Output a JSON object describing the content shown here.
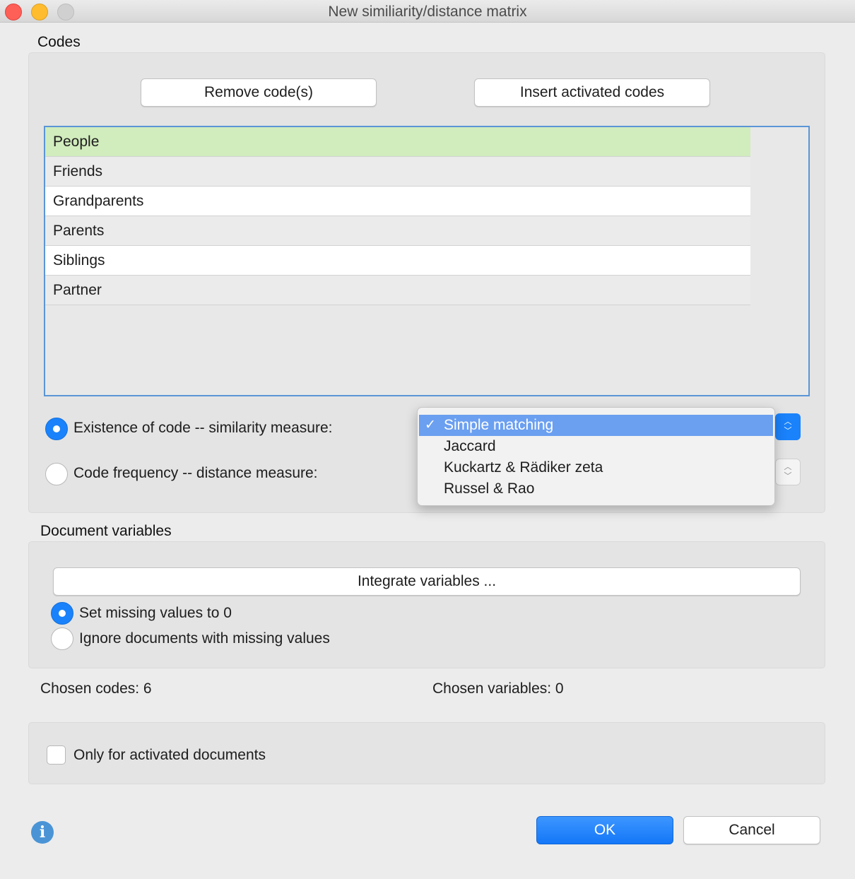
{
  "window": {
    "title": "New similiarity/distance matrix"
  },
  "codes": {
    "section_label": "Codes",
    "remove_button": "Remove code(s)",
    "insert_button": "Insert activated codes",
    "items": [
      {
        "label": "People"
      },
      {
        "label": "Friends"
      },
      {
        "label": "Grandparents"
      },
      {
        "label": "Parents"
      },
      {
        "label": "Siblings"
      },
      {
        "label": "Partner"
      }
    ],
    "selected_item": "People"
  },
  "measure": {
    "existence_label": "Existence of code -- similarity measure:",
    "frequency_label": "Code frequency -- distance measure:",
    "selected_radio": "existence",
    "dropdown_options": [
      "Simple matching",
      "Jaccard",
      "Kuckartz & Rädiker zeta",
      "Russel & Rao"
    ],
    "dropdown_selected": "Simple matching",
    "checkmark": "✓"
  },
  "variables": {
    "section_label": "Document variables",
    "integrate_button": "Integrate variables ...",
    "missing_zero_label": "Set missing values to 0",
    "ignore_missing_label": "Ignore documents with missing values",
    "selected_radio": "missing_zero"
  },
  "summary": {
    "chosen_codes": "Chosen codes: 6",
    "chosen_variables": "Chosen variables: 0"
  },
  "options": {
    "only_activated_label": "Only for activated documents",
    "only_activated_checked": false
  },
  "footer": {
    "info_icon_glyph": "i",
    "ok_label": "OK",
    "cancel_label": "Cancel"
  },
  "colors": {
    "accent": "#1a82fb",
    "selected_row": "#d1ecbd",
    "menu_highlight": "#6b9ff0",
    "info_icon": "#4a94d6"
  }
}
